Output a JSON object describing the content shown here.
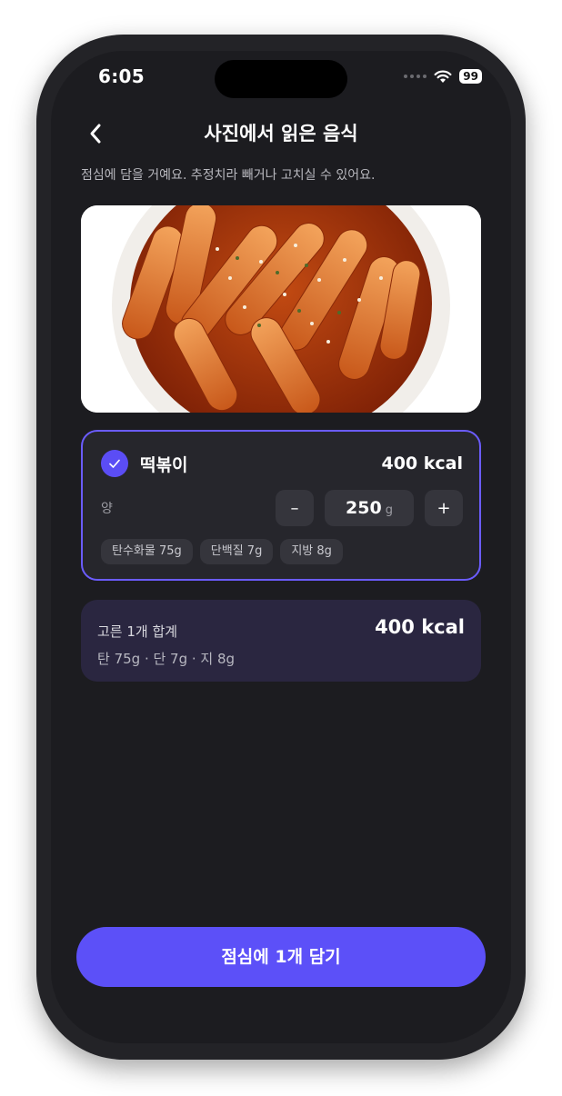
{
  "status_bar": {
    "time": "6:05",
    "battery": "99"
  },
  "header": {
    "title": "사진에서 읽은 음식",
    "subtitle": "점심에 담을 거예요. 추정치라 빼거나 고치실 수 있어요."
  },
  "food_item": {
    "name": "떡볶이",
    "kcal": "400 kcal",
    "quantity_label": "양",
    "quantity_value": "250",
    "quantity_unit": "g",
    "decrement_label": "–",
    "increment_label": "+",
    "macros": [
      "탄수화물 75g",
      "단백질 7g",
      "지방 8g"
    ],
    "selected": true
  },
  "summary": {
    "label": "고른 1개 합계",
    "kcal": "400 kcal",
    "macros": "탄 75g · 단 7g · 지 8g"
  },
  "cta": {
    "label": "점심에 1개 담기"
  },
  "colors": {
    "accent": "#5c50f8",
    "background": "#1c1c20",
    "card": "#26262c",
    "summary_card": "#2a2640",
    "card_border": "#6b5cff"
  },
  "icons": {
    "back": "chevron-left-icon",
    "check": "check-icon",
    "wifi": "wifi-icon",
    "battery": "battery-icon"
  }
}
